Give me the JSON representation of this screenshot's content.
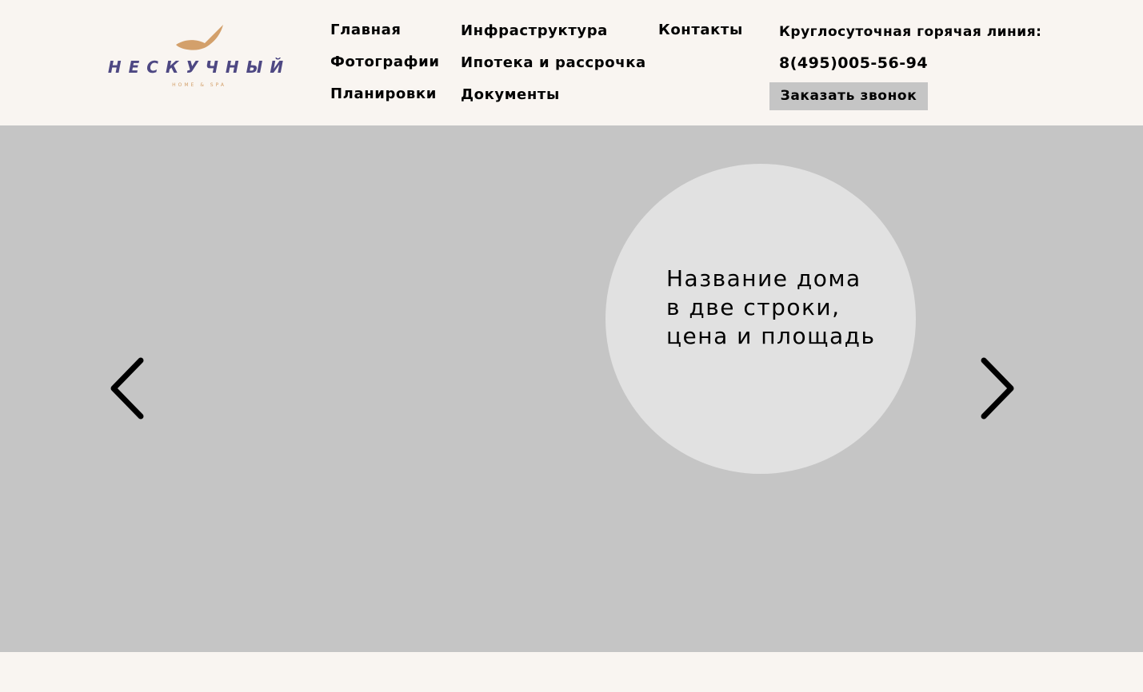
{
  "logo": {
    "wordmark": "НЕСКУЧНЫЙ",
    "tagline": "HOME & SPA",
    "colors": {
      "wordmark": "#4e4883",
      "bird": "#d3a06b"
    },
    "icon": "eagle-icon"
  },
  "nav": {
    "main": "Главная",
    "photos": "Фотографии",
    "layouts": "Планировки",
    "infrastructure": "Инфраструктура",
    "mortgage": "Ипотека и рассрочка",
    "documents": "Документы",
    "contacts": "Контакты"
  },
  "hotline": {
    "label": "Круглосуточная горячая линия:",
    "phone": "8(495)005-56-94",
    "callback_button": "Заказать звонок"
  },
  "slider": {
    "title": "Название дома\nв две строки,\nцена и площадь",
    "prev_icon": "chevron-left-icon",
    "next_icon": "chevron-right-icon",
    "colors": {
      "background": "#c5c5c5",
      "circle": "#e1e1e1"
    }
  },
  "colors": {
    "page_background": "#f9f5f1",
    "button_background": "#c5c5c5"
  }
}
